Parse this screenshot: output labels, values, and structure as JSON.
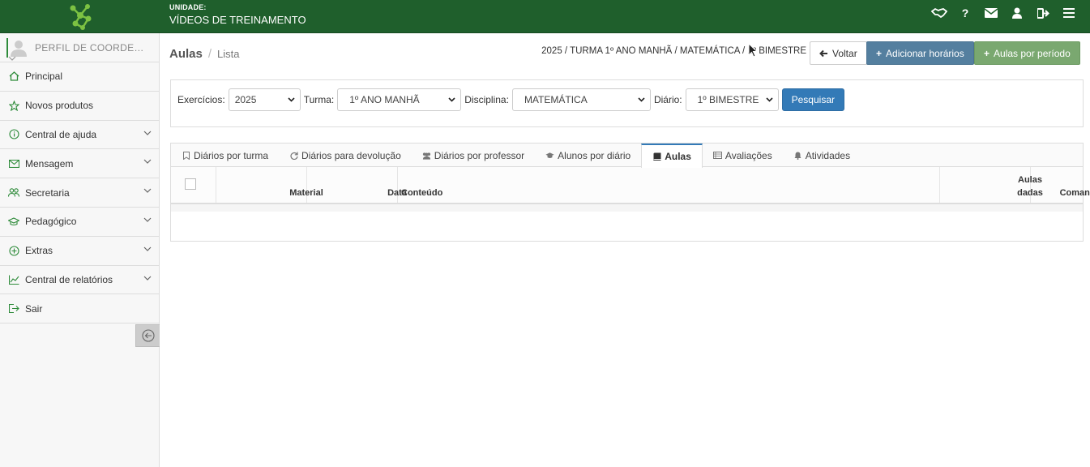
{
  "header": {
    "unit_label": "UNIDADE:",
    "unit_name": "VÍDEOS DE TREINAMENTO",
    "icons": [
      "handshake-icon",
      "help-icon",
      "mail-icon",
      "user-icon",
      "logout-icon",
      "hamburger-menu-icon"
    ],
    "brand_color": "#1f5f2c"
  },
  "sidebar": {
    "profile_name": "PERFIL DE COORDEN…",
    "items": [
      {
        "label": "Principal",
        "icon": "home-icon",
        "has_submenu": false
      },
      {
        "label": "Novos produtos",
        "icon": "star-icon",
        "has_submenu": false
      },
      {
        "label": "Central de ajuda",
        "icon": "info-icon",
        "has_submenu": true
      },
      {
        "label": "Mensagem",
        "icon": "envelope-icon",
        "has_submenu": true
      },
      {
        "label": "Secretaria",
        "icon": "users-icon",
        "has_submenu": true
      },
      {
        "label": "Pedagógico",
        "icon": "graduation-cap-icon",
        "has_submenu": true
      },
      {
        "label": "Extras",
        "icon": "plus-circle-icon",
        "has_submenu": true
      },
      {
        "label": "Central de relatórios",
        "icon": "line-chart-icon",
        "has_submenu": true
      },
      {
        "label": "Sair",
        "icon": "sign-out-icon",
        "has_submenu": false
      }
    ]
  },
  "breadcrumb": {
    "section": "Aulas",
    "page": "Lista"
  },
  "selection_path": "2025 / TURMA 1º ANO MANHÃ / MATEMÁTICA / 1º BIMESTRE",
  "actions": {
    "back_label": "Voltar",
    "add_schedule_label": "Adicionar horários",
    "lessons_by_period_label": "Aulas por período"
  },
  "filters": {
    "exercicios_label": "Exercícios:",
    "exercicios_value": "2025",
    "turma_label": "Turma:",
    "turma_value": "1º ANO MANHÃ",
    "disciplina_label": "Disciplina:",
    "disciplina_value": "MATEMÁTICA",
    "diario_label": "Diário:",
    "diario_value": "1º BIMESTRE",
    "search_label": "Pesquisar"
  },
  "tabs": [
    {
      "label": "Diários por turma",
      "icon": "bookmark-icon",
      "active": false
    },
    {
      "label": "Diários para devolução",
      "icon": "refresh-icon",
      "active": false
    },
    {
      "label": "Diários por professor",
      "icon": "users-icon",
      "active": false
    },
    {
      "label": "Alunos por diário",
      "icon": "graduation-cap-icon",
      "active": false
    },
    {
      "label": "Aulas",
      "icon": "book-icon",
      "active": true
    },
    {
      "label": "Avaliações",
      "icon": "list-icon",
      "active": false
    },
    {
      "label": "Atividades",
      "icon": "bell-icon",
      "active": false
    }
  ],
  "table": {
    "columns": {
      "material": "Material",
      "data": "Data",
      "conteudo": "Conteúdo",
      "aulas_dadas_1": "Aulas",
      "aulas_dadas_2": "dadas",
      "comandos": "Comandos"
    }
  }
}
